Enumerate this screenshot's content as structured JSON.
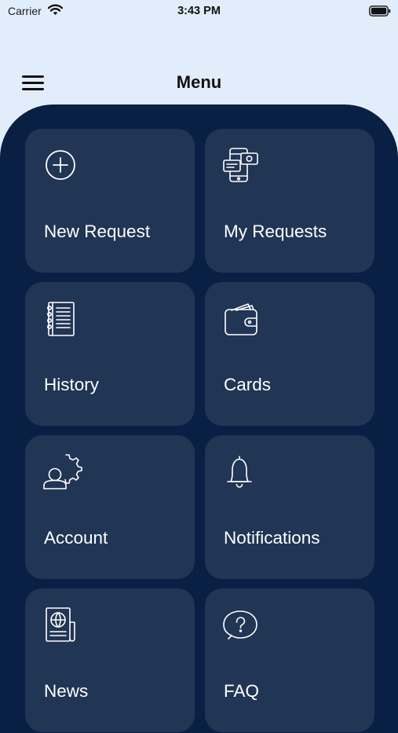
{
  "status_bar": {
    "carrier": "Carrier",
    "time": "3:43 PM"
  },
  "nav": {
    "title": "Menu",
    "menu_icon": "hamburger-icon"
  },
  "colors": {
    "background": "#e2edfb",
    "panel": "#0a1f44",
    "tile": "#213555",
    "tile_text": "#ffffff"
  },
  "menu": {
    "items": [
      {
        "label": "New Request",
        "icon": "add-circle-icon"
      },
      {
        "label": "My Requests",
        "icon": "phone-chat-icon"
      },
      {
        "label": "History",
        "icon": "notebook-icon"
      },
      {
        "label": "Cards",
        "icon": "wallet-icon"
      },
      {
        "label": "Account",
        "icon": "user-gear-icon"
      },
      {
        "label": "Notifications",
        "icon": "bell-icon"
      },
      {
        "label": "News",
        "icon": "newspaper-globe-icon"
      },
      {
        "label": "FAQ",
        "icon": "question-bubble-icon"
      }
    ]
  }
}
